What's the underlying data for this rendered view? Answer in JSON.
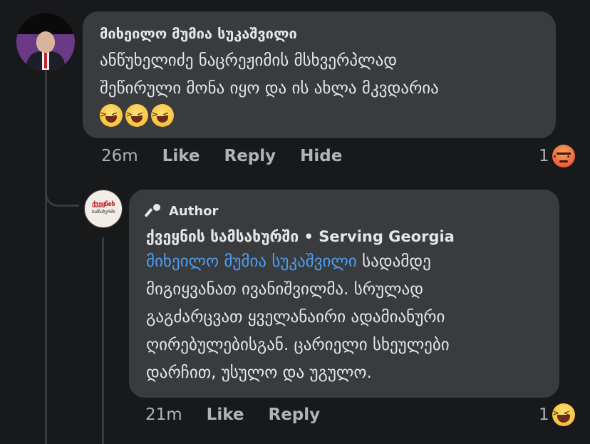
{
  "comment": {
    "author": "მიხეილო მუმია სუკაშვილი",
    "text_line1": "ანწუხელიძე ნაცრეჟიმის მსხვერპლად",
    "text_line2": "შეწირული მონა იყო და ის ახლა მკვდარია",
    "emojis": [
      "laughing-emoji",
      "laughing-emoji",
      "laughing-emoji"
    ],
    "time": "26m",
    "actions": [
      "Like",
      "Reply",
      "Hide"
    ],
    "reaction_count": "1",
    "reaction_icon": "angry-emoji"
  },
  "reply": {
    "badge": "Author",
    "badge_icon": "microphone-icon",
    "author": "ქვეყნის სამსახურში • Serving Georgia",
    "mention": "მიხეილო მუმია სუკაშვილი",
    "text_line1_rest": " სადამდე",
    "text_line2": "მიგიყვანათ ივანიშვილმა. სრულად",
    "text_line3": "გაგძარცვათ ყველანაირი ადამიანური",
    "text_line4": "ღირებულებისგან. ცარიელი სხეულები",
    "text_line5": "დარჩით, უსულო და უგულო.",
    "avatar_logo_top": "ქვეყნის",
    "avatar_logo_bottom": "სამსახურში",
    "time": "21m",
    "actions": [
      "Like",
      "Reply"
    ],
    "reaction_count": "1",
    "reaction_icon": "haha-emoji"
  },
  "colors": {
    "background": "#18191a",
    "bubble": "#3a3b3c",
    "text": "#e4e6eb",
    "secondary_text": "#b0b3b8",
    "mention": "#4b9ff5"
  }
}
